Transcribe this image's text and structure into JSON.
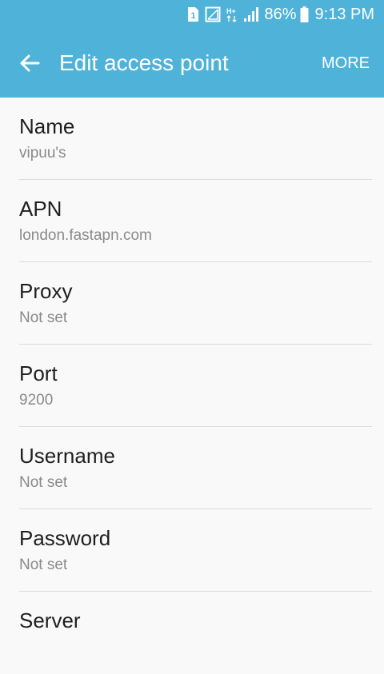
{
  "status_bar": {
    "battery": "86%",
    "time": "9:13 PM",
    "icons": [
      "sim1-icon",
      "sim2-no-signal-icon",
      "hplus-data-icon",
      "signal-icon",
      "battery-icon"
    ]
  },
  "header": {
    "title": "Edit access point",
    "more_label": "MORE",
    "back_icon": "arrow-left-icon"
  },
  "fields": [
    {
      "label": "Name",
      "value": "vipuu's"
    },
    {
      "label": "APN",
      "value": "london.fastapn.com"
    },
    {
      "label": "Proxy",
      "value": "Not set"
    },
    {
      "label": "Port",
      "value": "9200"
    },
    {
      "label": "Username",
      "value": "Not set"
    },
    {
      "label": "Password",
      "value": "Not set"
    },
    {
      "label": "Server",
      "value": ""
    }
  ],
  "colors": {
    "app_bar": "#4fb3d9",
    "background": "#f9f9f9",
    "label": "#1f1f1f",
    "value": "#8a8a8a",
    "divider": "#dcdcdc"
  }
}
